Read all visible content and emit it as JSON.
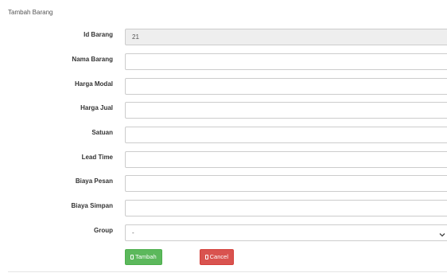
{
  "page": {
    "title": "Tambah Barang"
  },
  "form": {
    "id_barang": {
      "label": "Id Barang",
      "value": "21"
    },
    "nama_barang": {
      "label": "Nama Barang",
      "value": ""
    },
    "harga_modal": {
      "label": "Harga Modal",
      "value": ""
    },
    "harga_jual": {
      "label": "Harga Jual",
      "value": ""
    },
    "satuan": {
      "label": "Satuan",
      "value": ""
    },
    "lead_time": {
      "label": "Lead Time",
      "value": ""
    },
    "biaya_pesan": {
      "label": "Biaya Pesan",
      "value": ""
    },
    "biaya_simpan": {
      "label": "Biaya Simpan",
      "value": ""
    },
    "group": {
      "label": "Group",
      "selected": "-"
    }
  },
  "actions": {
    "tambah_label": "Tambah",
    "cancel_label": "Cancel"
  },
  "colors": {
    "success": "#5cb85c",
    "danger": "#d9534f",
    "readonly_bg": "#eeeeee",
    "border": "#cccccc"
  },
  "icons": {
    "tambah": "save-icon",
    "cancel": "cancel-icon",
    "select": "chevron-down-icon"
  }
}
